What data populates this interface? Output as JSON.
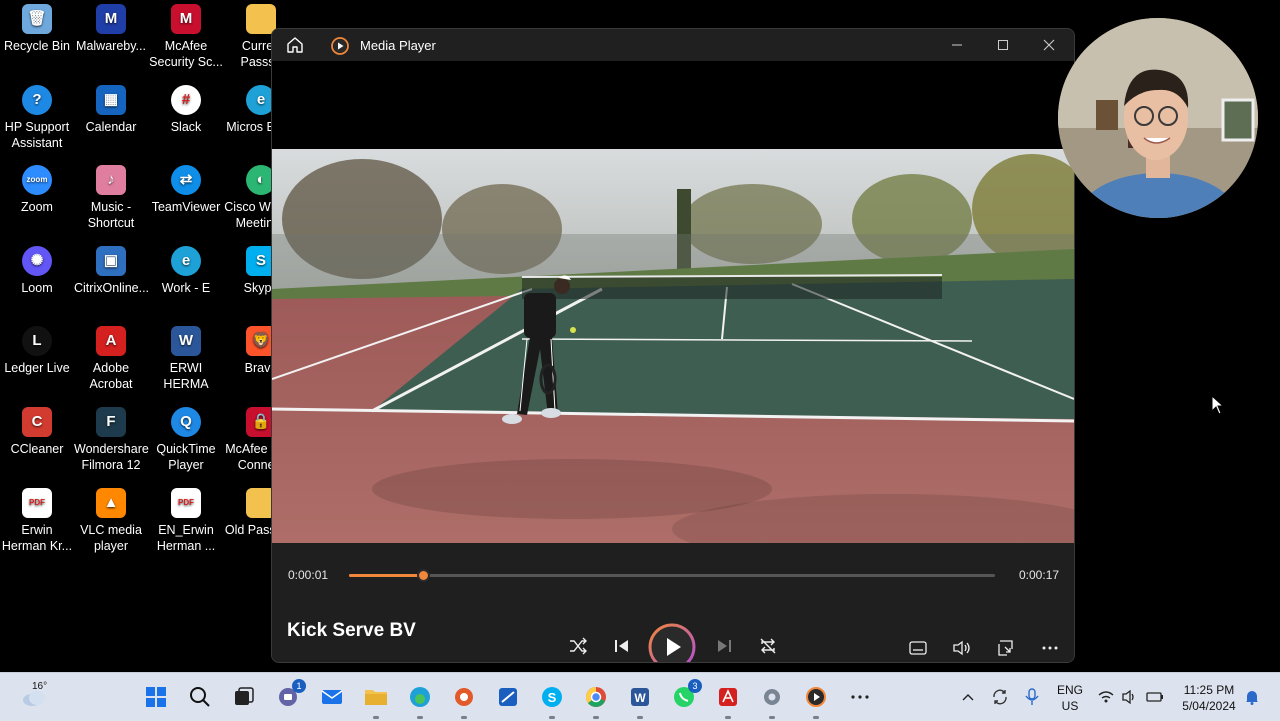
{
  "desktop": {
    "icons": [
      {
        "label": "Recycle Bin",
        "icon": "recycle-bin-icon",
        "color": "#6fa8dc",
        "glyph": "🗑"
      },
      {
        "label": "Malwareby...",
        "icon": "malwarebytes-icon",
        "color": "#1f3ea8",
        "glyph": "M"
      },
      {
        "label": "McAfee Security Sc...",
        "icon": "mcafee-icon",
        "color": "#c8102e",
        "glyph": "M"
      },
      {
        "label": "Curren Passsp",
        "icon": "folder-icon",
        "color": "#f2c14e",
        "glyph": ""
      },
      {
        "label": "HP Support Assistant",
        "icon": "hp-support-icon",
        "color": "#1e88e5",
        "glyph": "?"
      },
      {
        "label": "Calendar",
        "icon": "calendar-icon",
        "color": "#1565c0",
        "glyph": "▦"
      },
      {
        "label": "Slack",
        "icon": "slack-icon",
        "color": "#ffffff",
        "glyph": "#"
      },
      {
        "label": "Micros Edge",
        "icon": "edge-icon",
        "color": "#1da1d6",
        "glyph": "e"
      },
      {
        "label": "Zoom",
        "icon": "zoom-icon",
        "color": "#2d8cff",
        "glyph": "zoom"
      },
      {
        "label": "Music - Shortcut",
        "icon": "music-folder-icon",
        "color": "#e07ea0",
        "glyph": "♪"
      },
      {
        "label": "TeamViewer",
        "icon": "teamviewer-icon",
        "color": "#0e8ee9",
        "glyph": "⇄"
      },
      {
        "label": "Cisco Webex Meetings",
        "icon": "webex-icon",
        "color": "#2bb673",
        "glyph": "◐"
      },
      {
        "label": "Loom",
        "icon": "loom-icon",
        "color": "#6256f6",
        "glyph": "✺"
      },
      {
        "label": "CitrixOnline...",
        "icon": "citrix-icon",
        "color": "#2f6fbf",
        "glyph": "▣"
      },
      {
        "label": "Work - E",
        "icon": "edge-work-icon",
        "color": "#1da1d6",
        "glyph": "e"
      },
      {
        "label": "Skype",
        "icon": "skype-icon",
        "color": "#00aff0",
        "glyph": "S"
      },
      {
        "label": "Ledger Live",
        "icon": "ledger-icon",
        "color": "#111111",
        "glyph": "L"
      },
      {
        "label": "Adobe Acrobat",
        "icon": "acrobat-icon",
        "color": "#d4201e",
        "glyph": "A"
      },
      {
        "label": "ERWI HERMA",
        "icon": "word-doc-icon",
        "color": "#2b579a",
        "glyph": "W"
      },
      {
        "label": "Brave",
        "icon": "brave-icon",
        "color": "#fb542b",
        "glyph": "🦁"
      },
      {
        "label": "CCleaner",
        "icon": "ccleaner-icon",
        "color": "#d23b2f",
        "glyph": "C"
      },
      {
        "label": "Wondershare Filmora 12",
        "icon": "filmora-icon",
        "color": "#1d3b4c",
        "glyph": "F"
      },
      {
        "label": "QuickTime Player",
        "icon": "quicktime-icon",
        "color": "#1e88e5",
        "glyph": "Q"
      },
      {
        "label": "McAfee Safe Connect",
        "icon": "mcafee-safe-connect-icon",
        "color": "#c8102e",
        "glyph": "🔒"
      },
      {
        "label": "Erwin Herman Kr...",
        "icon": "pdf-icon",
        "color": "#ffffff",
        "glyph": "PDF"
      },
      {
        "label": "VLC media player",
        "icon": "vlc-icon",
        "color": "#ff8800",
        "glyph": "▲"
      },
      {
        "label": "EN_Erwin Herman ...",
        "icon": "pdf-icon",
        "color": "#ffffff",
        "glyph": "PDF"
      },
      {
        "label": "Old Passport",
        "icon": "folder-icon",
        "color": "#f2c14e",
        "glyph": ""
      }
    ]
  },
  "media_player": {
    "app_title": "Media Player",
    "elapsed": "0:00:01",
    "duration": "0:00:17",
    "progress_fraction": 0.115,
    "media_title": "Kick Serve BV",
    "accent": "#f0873a"
  },
  "taskbar": {
    "temperature": "16°",
    "apps": [
      {
        "name": "start-button",
        "glyph": "start"
      },
      {
        "name": "search-button",
        "glyph": "search"
      },
      {
        "name": "task-view-button",
        "glyph": "taskview"
      },
      {
        "name": "teams-chat-button",
        "glyph": "chat",
        "badge": "1"
      },
      {
        "name": "mail-button",
        "glyph": "mail"
      },
      {
        "name": "file-explorer-button",
        "glyph": "folder",
        "running": true
      },
      {
        "name": "edge-button",
        "glyph": "edge",
        "running": true
      },
      {
        "name": "screen-recorder-button",
        "glyph": "rec",
        "running": true
      },
      {
        "name": "snipping-tool-button",
        "glyph": "snip"
      },
      {
        "name": "skype-button",
        "glyph": "skype",
        "running": true
      },
      {
        "name": "chrome-button",
        "glyph": "chrome",
        "running": true
      },
      {
        "name": "word-button",
        "glyph": "word",
        "running": true
      },
      {
        "name": "whatsapp-button",
        "glyph": "whatsapp",
        "badge": "3"
      },
      {
        "name": "acrobat-button",
        "glyph": "acrobat",
        "running": true
      },
      {
        "name": "settings-button",
        "glyph": "settings",
        "running": true
      },
      {
        "name": "media-player-button",
        "glyph": "media",
        "running": true
      },
      {
        "name": "more-apps-button",
        "glyph": "more"
      }
    ],
    "lang_line1": "ENG",
    "lang_line2": "US",
    "time": "11:25 PM",
    "date": "5/04/2024"
  }
}
